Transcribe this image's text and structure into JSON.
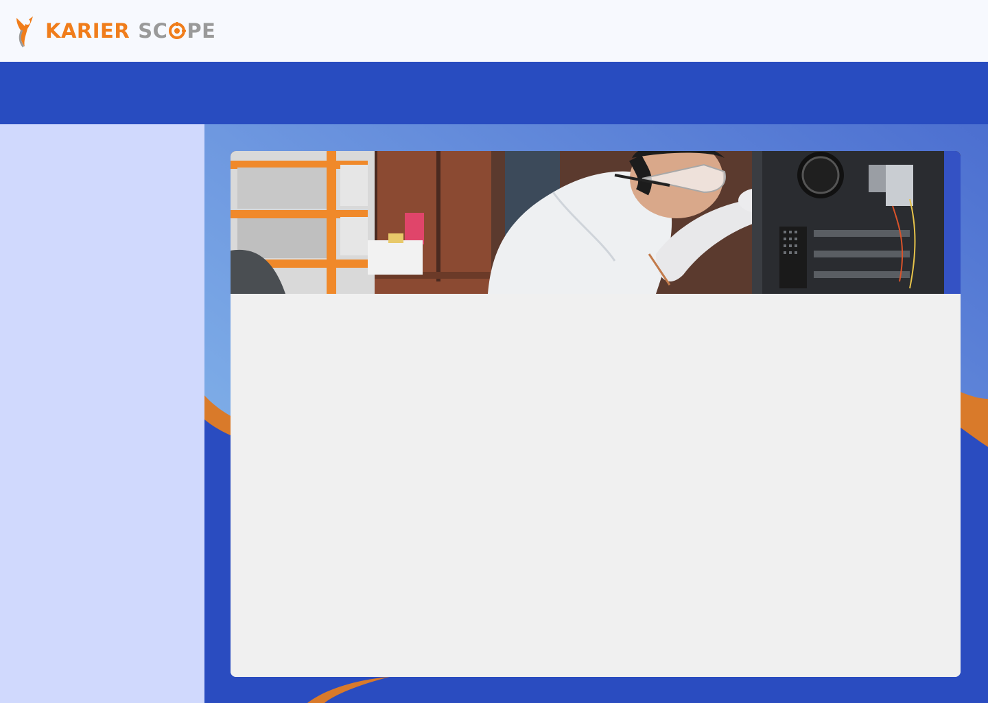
{
  "header": {
    "logo": {
      "word1": "KARIER",
      "word2_start": "SC",
      "word2_end": "PE",
      "mark_icon": "person-leaping-icon",
      "target_icon": "target-icon"
    }
  },
  "banner": {
    "image": "technician-repairing-computer"
  },
  "colors": {
    "brand_orange": "#f07d1b",
    "brand_gray": "#9a9a9a",
    "primary_blue": "#284cc0",
    "sidebar_bg": "#d0d9fd",
    "card_bg": "#f0f0f0"
  }
}
